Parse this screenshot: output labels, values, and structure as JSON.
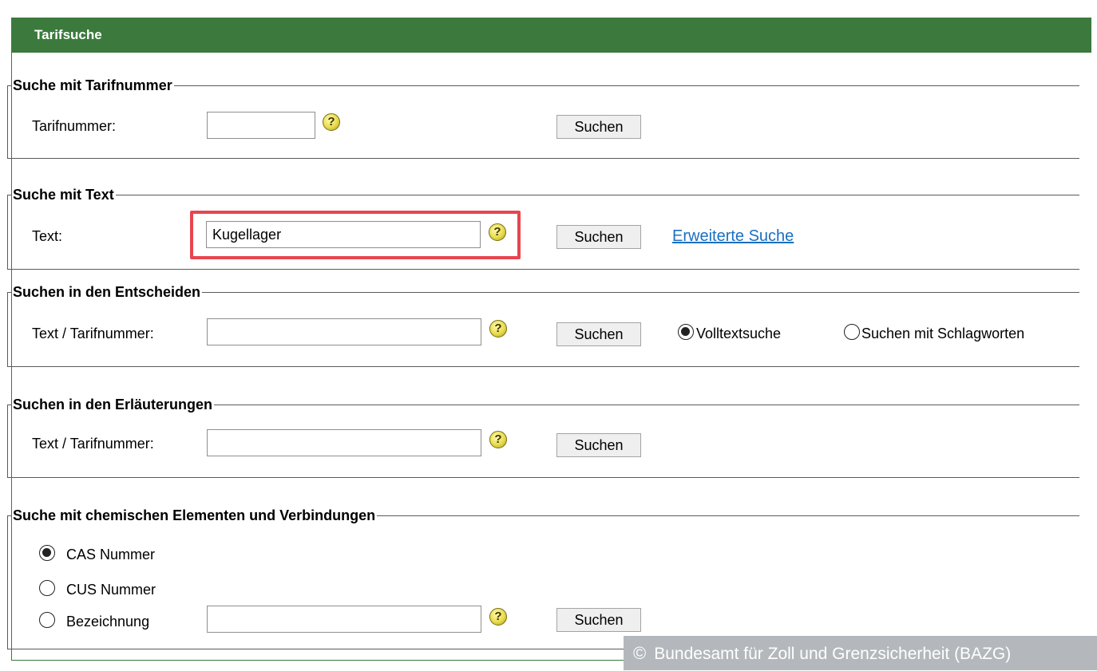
{
  "panel": {
    "title": "Tarifsuche"
  },
  "tariff_number_search": {
    "legend": "Suche mit Tarifnummer",
    "label": "Tarifnummer:",
    "value": "",
    "button": "Suchen"
  },
  "text_search": {
    "legend": "Suche mit Text",
    "label": "Text:",
    "value": "Kugellager",
    "button": "Suchen",
    "advanced_link": "Erweiterte Suche"
  },
  "decisions_search": {
    "legend": "Suchen in den Entscheiden",
    "label": "Text / Tarifnummer:",
    "value": "",
    "button": "Suchen",
    "options": [
      {
        "label": "Volltextsuche",
        "checked": true
      },
      {
        "label": "Suchen mit Schlagworten",
        "checked": false
      }
    ]
  },
  "explanations_search": {
    "legend": "Suchen in den Erläuterungen",
    "label": "Text / Tarifnummer:",
    "value": "",
    "button": "Suchen"
  },
  "chemical_search": {
    "legend": "Suche mit chemischen Elementen und Verbindungen",
    "options": [
      {
        "label": "CAS Nummer",
        "checked": true
      },
      {
        "label": "CUS Nummer",
        "checked": false
      },
      {
        "label": "Bezeichnung",
        "checked": false
      }
    ],
    "value": "",
    "button": "Suchen"
  },
  "help_icon": {
    "glyph": "?"
  },
  "credit": {
    "symbol": "©",
    "text": "Bundesamt für Zoll und Grenzsicherheit (BAZG)"
  },
  "colors": {
    "header": "#3b7a3c",
    "highlight": "#e8454f",
    "link": "#1a6fc2",
    "credit_bg": "#b4b8bc"
  }
}
